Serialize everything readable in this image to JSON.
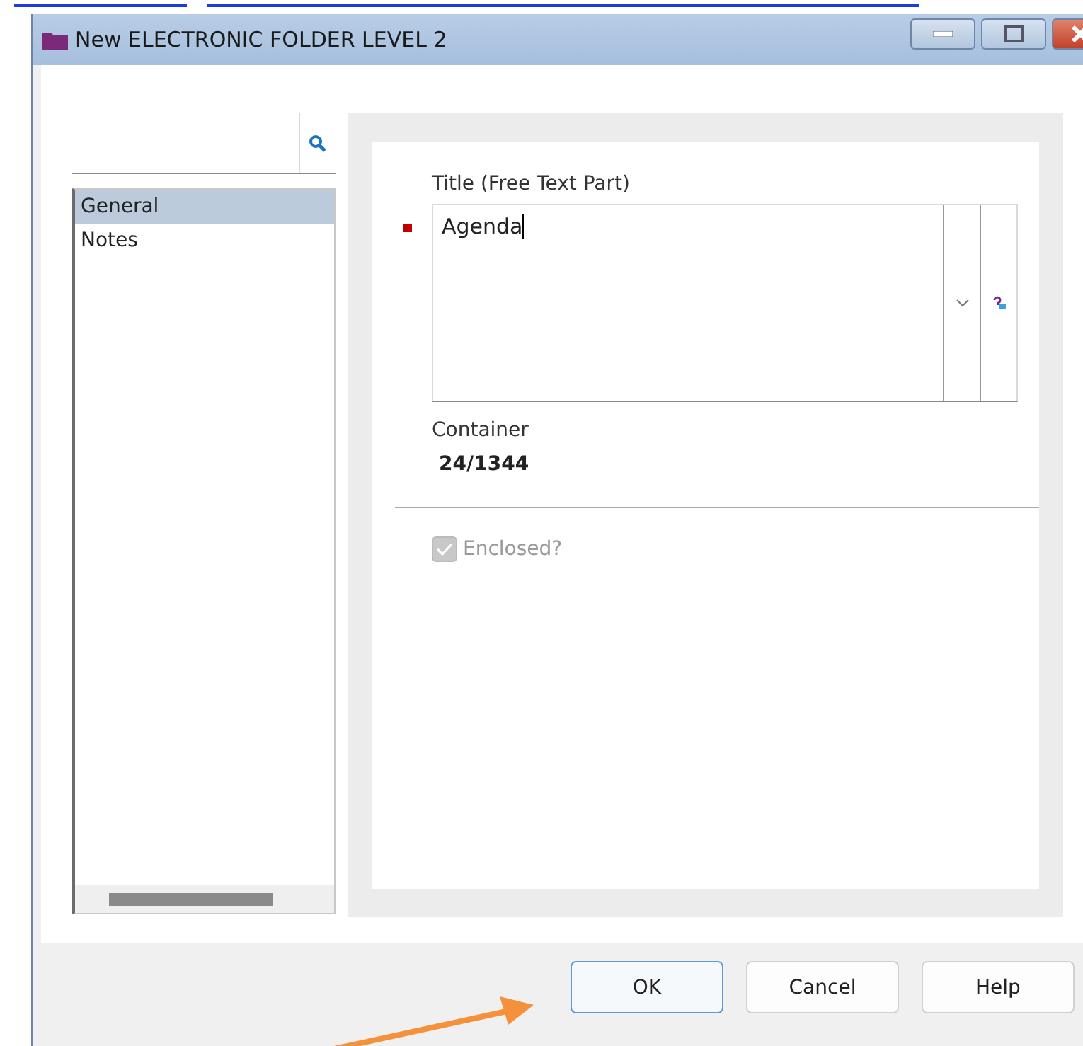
{
  "window": {
    "title": "New ELECTRONIC FOLDER LEVEL 2"
  },
  "sidebar": {
    "items": [
      {
        "label": "General",
        "selected": true
      },
      {
        "label": "Notes",
        "selected": false
      }
    ]
  },
  "form": {
    "title_field": {
      "label": "Title (Free Text Part)",
      "value": "Agenda",
      "required": true
    },
    "container": {
      "label": "Container",
      "value": "24/1344"
    },
    "enclosed": {
      "label": "Enclosed?",
      "checked": true,
      "disabled": true
    }
  },
  "buttons": [
    {
      "label": "OK",
      "focused": true
    },
    {
      "label": "Cancel",
      "focused": false
    },
    {
      "label": "Help",
      "focused": false
    }
  ]
}
